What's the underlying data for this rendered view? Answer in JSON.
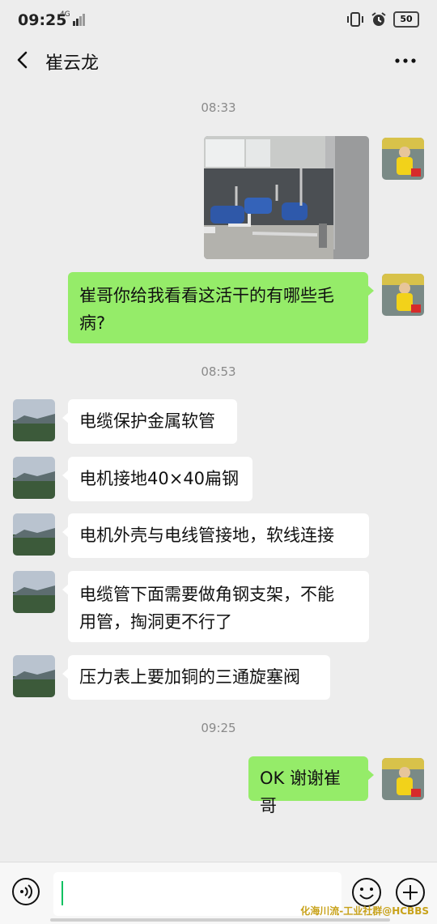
{
  "status": {
    "time": "09:25",
    "network": "4G",
    "battery": "50"
  },
  "header": {
    "title": "崔云龙"
  },
  "timestamps": [
    "08:33",
    "08:53",
    "09:25"
  ],
  "messages": [
    {
      "from": "me",
      "type": "image"
    },
    {
      "from": "me",
      "type": "text",
      "lines": [
        "崔哥你给我看看这活干的有哪些毛",
        "病?"
      ]
    },
    {
      "from": "contact",
      "type": "text",
      "lines": [
        "电缆保护金属软管"
      ]
    },
    {
      "from": "contact",
      "type": "text",
      "lines": [
        "电机接地40×40扁钢"
      ]
    },
    {
      "from": "contact",
      "type": "text",
      "lines": [
        "电机外壳与电线管接地，软线连接"
      ]
    },
    {
      "from": "contact",
      "type": "text",
      "lines": [
        "电缆管下面需要做角钢支架，不能",
        "用管，掏洞更不行了"
      ]
    },
    {
      "from": "contact",
      "type": "text",
      "lines": [
        "压力表上要加铜的三通旋塞阀"
      ]
    },
    {
      "from": "me",
      "type": "text",
      "lines": [
        "OK 谢谢崔哥"
      ]
    }
  ],
  "input": {
    "value": ""
  },
  "watermark": "化海川流-工业社群@HCBBS",
  "colors": {
    "outgoing_bubble": "#95ec69",
    "incoming_bubble": "#ffffff",
    "background": "#ededed",
    "caret": "#07c160"
  },
  "icons": [
    "back-arrow-icon",
    "more-icon",
    "voice-icon",
    "emoji-icon",
    "plus-icon"
  ]
}
